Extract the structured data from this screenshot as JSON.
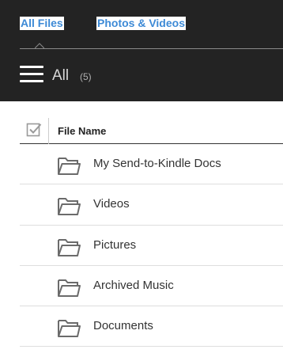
{
  "tabs": {
    "all_files": "All Files",
    "photos_videos": "Photos & Videos"
  },
  "view": {
    "title": "All",
    "count": "(5)"
  },
  "table": {
    "column_name": "File Name"
  },
  "files": [
    {
      "name": "My Send-to-Kindle Docs",
      "icon": "folder-icon"
    },
    {
      "name": "Videos",
      "icon": "folder-icon"
    },
    {
      "name": "Pictures",
      "icon": "folder-icon"
    },
    {
      "name": "Archived Music",
      "icon": "folder-icon"
    },
    {
      "name": "Documents",
      "icon": "folder-icon"
    }
  ],
  "colors": {
    "header_bg": "#232323",
    "tab_link": "#3d8ad6",
    "folder_stroke": "#6b6b6b"
  }
}
